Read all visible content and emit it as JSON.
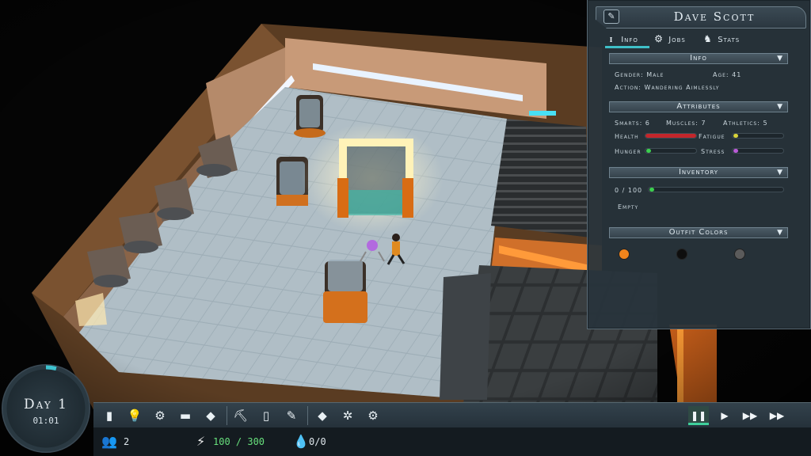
{
  "character": {
    "name": "Dave Scott",
    "tabs": [
      {
        "label": "Info",
        "icon": "info-icon",
        "active": true
      },
      {
        "label": "Jobs",
        "icon": "jobs-icon",
        "active": false
      },
      {
        "label": "Stats",
        "icon": "stats-icon",
        "active": false
      }
    ],
    "info": {
      "header": "Info",
      "gender": "Gender: Male",
      "age": "Age: 41",
      "action": "Action: Wandering Aimlessly"
    },
    "attributes": {
      "header": "Attributes",
      "smarts": "Smarts: 6",
      "muscles": "Muscles: 7",
      "athletics": "Athletics: 5",
      "health_label": "Health",
      "fatigue_label": "Fatigue",
      "hunger_label": "Hunger",
      "stress_label": "Stress",
      "health": 1.0,
      "fatigue": 0.05,
      "hunger": 0.03,
      "stress": 0.03,
      "colors": {
        "health": "#c4262b",
        "fatigue": "#d7d23a",
        "hunger": "#3ccf4f",
        "stress": "#b95bd6"
      }
    },
    "inventory": {
      "header": "Inventory",
      "count": "0 / 100",
      "fill": 0.0,
      "status": "Empty",
      "color": "#3ccf4f"
    },
    "outfit": {
      "header": "Outfit Colors",
      "colors": [
        "#f0841c",
        "#0e0e0e",
        "#5b5b5b"
      ]
    }
  },
  "hud": {
    "day": "Day 1",
    "time": "01:01",
    "day_progress": 0.04,
    "toolbar_icons": [
      "storage-icon",
      "light-bulb-icon",
      "gears-icon",
      "bed-icon",
      "crate-icon",
      "pickaxe-icon",
      "bin-icon",
      "shovel-icon",
      "box-icon",
      "network-icon",
      "settings-cog-icon"
    ],
    "speed_buttons": [
      "pause-icon",
      "play-icon",
      "fast-forward-icon",
      "fastest-forward-icon"
    ],
    "population": "2",
    "power": "100 / 300",
    "water": "0/0",
    "accent": "#3fcf9b"
  }
}
